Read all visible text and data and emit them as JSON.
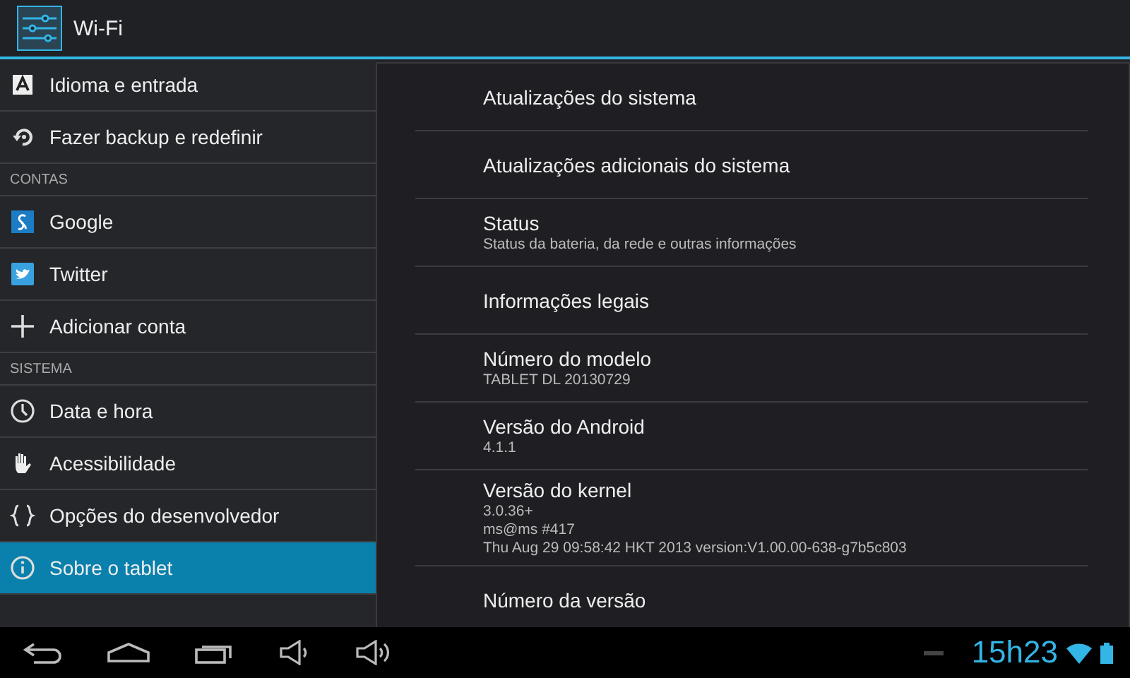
{
  "action_bar": {
    "title": "Wi-Fi"
  },
  "sidebar": {
    "items": [
      {
        "kind": "item",
        "label": "Idioma e entrada",
        "selected": false
      },
      {
        "kind": "item",
        "label": "Fazer backup e redefinir",
        "selected": false
      },
      {
        "kind": "header",
        "label": "CONTAS"
      },
      {
        "kind": "item",
        "label": "Google",
        "selected": false
      },
      {
        "kind": "item",
        "label": "Twitter",
        "selected": false
      },
      {
        "kind": "item",
        "label": "Adicionar conta",
        "selected": false
      },
      {
        "kind": "header",
        "label": "SISTEMA"
      },
      {
        "kind": "item",
        "label": "Data e hora",
        "selected": false
      },
      {
        "kind": "item",
        "label": "Acessibilidade",
        "selected": false
      },
      {
        "kind": "item",
        "label": "Opções do desenvolvedor",
        "selected": false
      },
      {
        "kind": "item",
        "label": "Sobre o tablet",
        "selected": true
      }
    ]
  },
  "detail": {
    "rows": [
      {
        "title": "Atualizações do sistema",
        "summary": []
      },
      {
        "title": "Atualizações adicionais do sistema",
        "summary": []
      },
      {
        "title": "Status",
        "summary": [
          "Status da bateria, da rede e outras informações"
        ]
      },
      {
        "title": "Informações legais",
        "summary": []
      },
      {
        "title": "Número do modelo",
        "summary": [
          "TABLET DL 20130729"
        ]
      },
      {
        "title": "Versão do Android",
        "summary": [
          "4.1.1"
        ]
      },
      {
        "title": "Versão do kernel",
        "summary": [
          "3.0.36+",
          "ms@ms #417",
          "Thu Aug 29 09:58:42 HKT 2013 version:V1.00.00-638-g7b5c803"
        ]
      },
      {
        "title": "Número da versão",
        "summary": []
      }
    ]
  },
  "status_bar": {
    "time": "15h23"
  }
}
